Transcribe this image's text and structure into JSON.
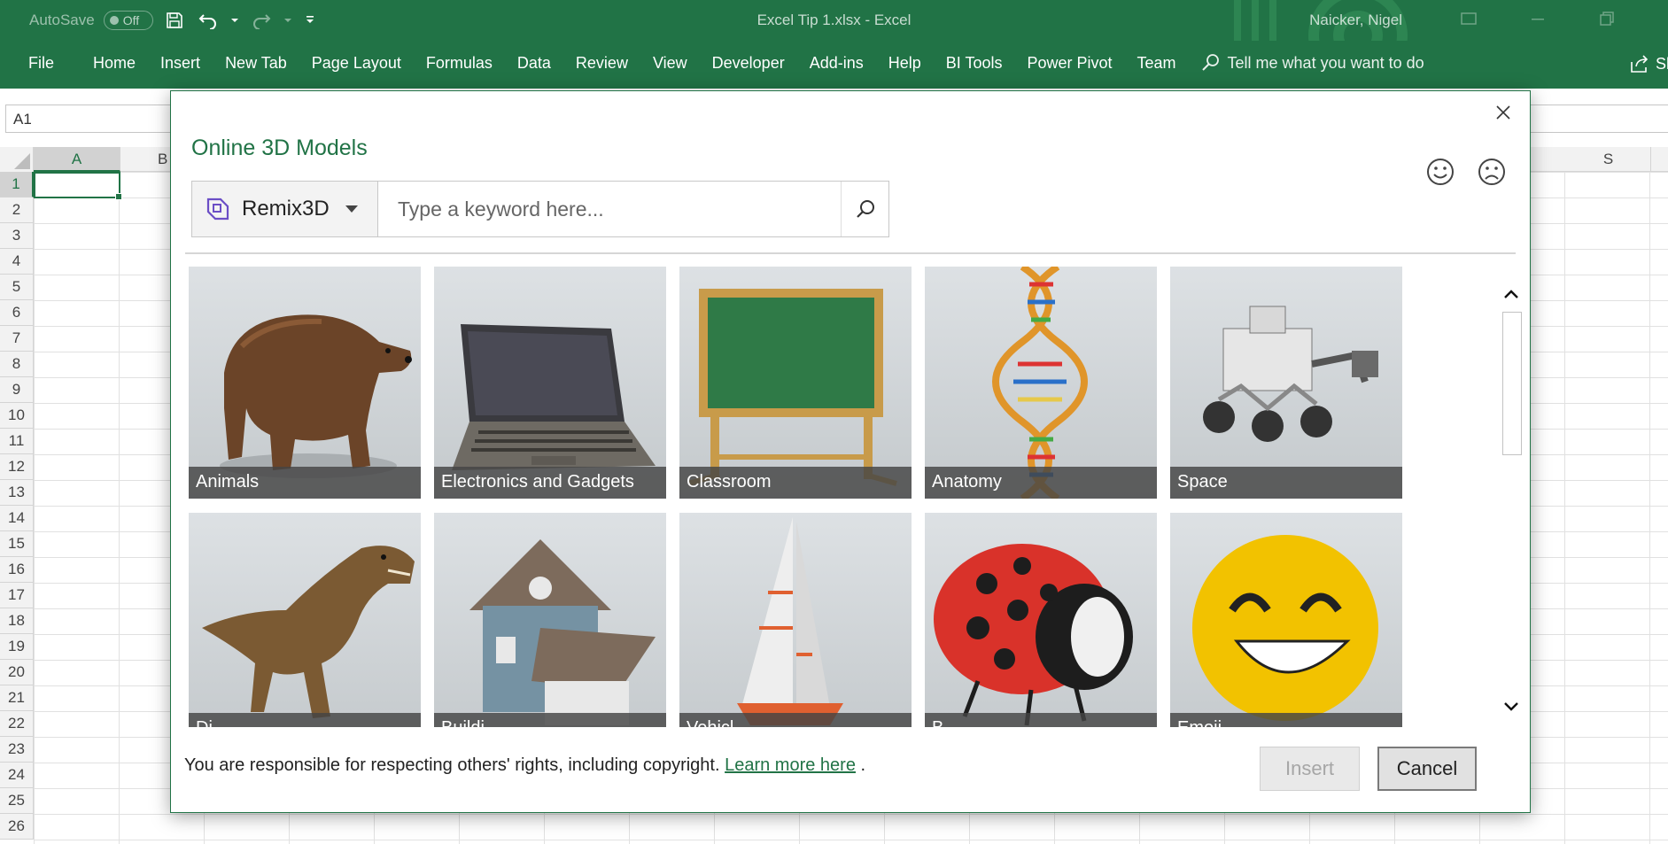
{
  "colors": {
    "accent": "#217346",
    "ribbon": "#217346",
    "caption_bg": "#444444",
    "link": "#217346"
  },
  "titlebar": {
    "autosave_label": "AutoSave",
    "autosave_state": "Off",
    "doc_title": "Excel Tip 1.xlsx  -  Excel",
    "user_name": "Naicker, Nigel",
    "icons": [
      "save-icon",
      "undo-icon",
      "redo-icon",
      "customize-qat-icon"
    ]
  },
  "ribbon": {
    "tabs": [
      "File",
      "Home",
      "Insert",
      "New Tab",
      "Page Layout",
      "Formulas",
      "Data",
      "Review",
      "View",
      "Developer",
      "Add-ins",
      "Help",
      "BI Tools",
      "Power Pivot",
      "Team"
    ],
    "tell_me": "Tell me what you want to do",
    "share_label": "Sh"
  },
  "formula_bar": {
    "name_box": "A1"
  },
  "grid": {
    "columns_visible": [
      "A",
      "B",
      "S"
    ],
    "rows": [
      "1",
      "2",
      "3",
      "4",
      "5",
      "6",
      "7",
      "8",
      "9",
      "10",
      "11",
      "12",
      "13",
      "14",
      "15",
      "16",
      "17",
      "18",
      "19",
      "20",
      "21",
      "22",
      "23",
      "24",
      "25",
      "26"
    ],
    "active_cell": "A1"
  },
  "dialog": {
    "title": "Online 3D Models",
    "source": {
      "label": "Remix3D",
      "icon": "remix3d-icon"
    },
    "search": {
      "placeholder": "Type a keyword here...",
      "value": ""
    },
    "feedback_icons": [
      "smiley-happy-icon",
      "smiley-sad-icon"
    ],
    "categories": [
      {
        "label": "Animals",
        "icon": "bear-icon"
      },
      {
        "label": "Electronics and Gadgets",
        "icon": "laptop-icon"
      },
      {
        "label": "Classroom",
        "icon": "chalkboard-icon"
      },
      {
        "label": "Anatomy",
        "icon": "dna-icon"
      },
      {
        "label": "Space",
        "icon": "rover-icon"
      },
      {
        "label": "Di",
        "icon": "dinosaur-icon"
      },
      {
        "label": "Buildi",
        "icon": "house-icon"
      },
      {
        "label": "Vehicl",
        "icon": "sailboat-icon"
      },
      {
        "label": "B",
        "icon": "ladybug-icon"
      },
      {
        "label": "Emoji",
        "icon": "emoji-icon"
      }
    ],
    "footer": {
      "notice": "You are responsible for respecting others' rights, including copyright.",
      "link": "Learn more here",
      "period": "."
    },
    "buttons": {
      "insert": "Insert",
      "cancel": "Cancel"
    }
  }
}
